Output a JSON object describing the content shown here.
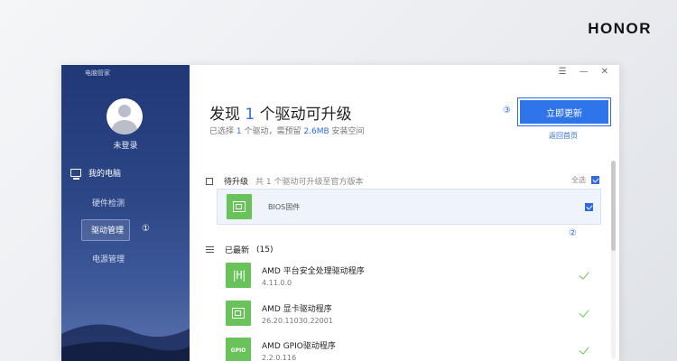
{
  "brand": "HONOR",
  "app_title": "电脑管家",
  "user": {
    "login_label": "未登录"
  },
  "nav": {
    "main": "我的电脑",
    "items": [
      "硬件检测",
      "驱动管理",
      "电源管理"
    ]
  },
  "markers": {
    "m1": "①",
    "m2": "②",
    "m3": "③"
  },
  "window_buttons": {
    "menu": "☰",
    "minimize": "—",
    "close": "✕"
  },
  "header": {
    "prefix": "发现",
    "count": "1",
    "suffix": "个驱动可升级",
    "sub_prefix": "已选择",
    "sub_count": "1",
    "sub_mid": "个驱动，需预留",
    "sub_size": "2.6MB",
    "sub_suffix": "安装空间"
  },
  "actions": {
    "update_now": "立即更新",
    "back_home": "返回首页"
  },
  "pending": {
    "title": "待升级",
    "desc": "共 1 个驱动可升级至官方版本",
    "select_all": "全选",
    "items": [
      {
        "name": "BIOS固件",
        "checked": true
      }
    ]
  },
  "latest": {
    "title": "已最新",
    "count": "(15)",
    "items": [
      {
        "name": "AMD 平台安全处理驱动程序",
        "version": "4.11.0.0",
        "icon": "amd-security-icon"
      },
      {
        "name": "AMD 显卡驱动程序",
        "version": "26.20.11030.22001",
        "icon": "chip-icon"
      },
      {
        "name": "AMD GPIO驱动程序",
        "version": "2.2.0.116",
        "icon": "gpio-icon",
        "icon_text": "GPIO"
      }
    ]
  },
  "colors": {
    "accent": "#2f6bdc",
    "green": "#6ac25a",
    "sidebar": "#213877"
  }
}
